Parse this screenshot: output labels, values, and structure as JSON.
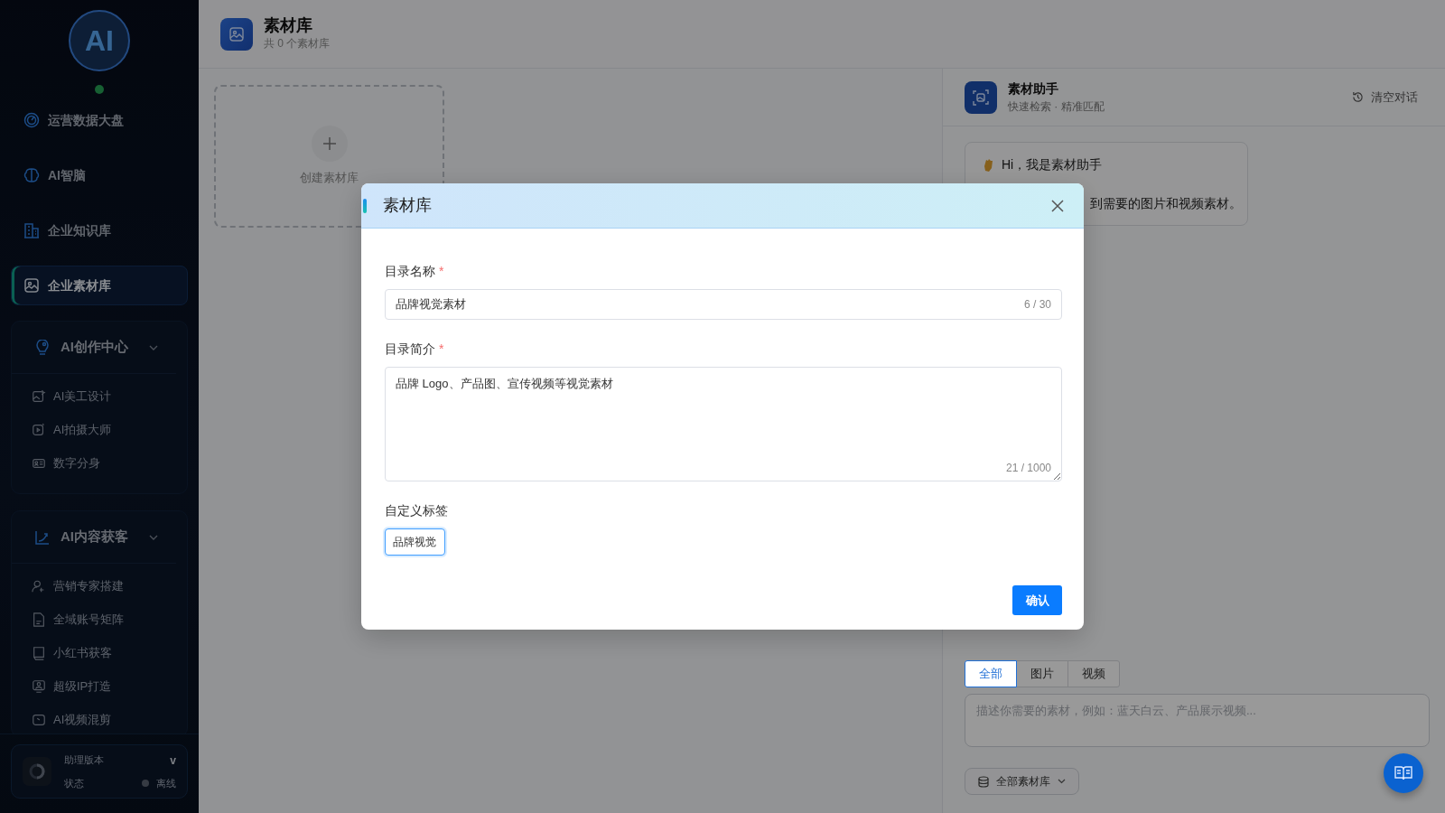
{
  "sidebar": {
    "logo": "AI",
    "nav_items": [
      {
        "label": "运营数据大盘",
        "selected": false
      },
      {
        "label": "AI智脑",
        "selected": false
      },
      {
        "label": "企业知识库",
        "selected": false
      },
      {
        "label": "企业素材库",
        "selected": true
      }
    ],
    "groups": [
      {
        "title": "AI创作中心",
        "expanded": true,
        "items": [
          {
            "label": "AI美工设计"
          },
          {
            "label": "AI拍摄大师"
          },
          {
            "label": "数字分身"
          }
        ]
      },
      {
        "title": "AI内容获客",
        "expanded": true,
        "items": [
          {
            "label": "营销专家搭建"
          },
          {
            "label": "全域账号矩阵"
          },
          {
            "label": "小红书获客"
          },
          {
            "label": "超级IP打造"
          },
          {
            "label": "AI视频混剪"
          }
        ]
      }
    ],
    "footer": {
      "version_label": "助理版本",
      "version_value": "v",
      "status_label": "状态",
      "status_value": "离线"
    }
  },
  "page_header": {
    "title": "素材库",
    "subtitle": "共 0 个素材库"
  },
  "create_card": {
    "label": "创建素材库"
  },
  "assistant": {
    "title": "素材助手",
    "subtitle": "快速检索 · 精准匹配",
    "clear_button": "清空对话",
    "message": {
      "greeting": "Hi，我是素材助手",
      "line": "到需要的图片和视频素材。"
    },
    "filter_tabs": [
      {
        "label": "全部",
        "selected": true
      },
      {
        "label": "图片",
        "selected": false
      },
      {
        "label": "视频",
        "selected": false
      }
    ],
    "input": {
      "placeholder": "描述你需要的素材，例如：蓝天白云、产品展示视频..."
    },
    "library_select": "全部素材库"
  },
  "modal": {
    "title": "素材库",
    "fields": [
      {
        "kind": "input",
        "label": "目录名称",
        "required_mark": "*",
        "value": "品牌视觉素材",
        "counter": "6 / 30"
      },
      {
        "kind": "textarea",
        "label": "目录简介",
        "required_mark": "*",
        "value": "品牌 Logo、产品图、宣传视频等视觉素材",
        "counter": "21 / 1000"
      },
      {
        "kind": "tag",
        "label": "自定义标签",
        "value": "品牌视觉"
      }
    ],
    "confirm_button": "确认"
  }
}
